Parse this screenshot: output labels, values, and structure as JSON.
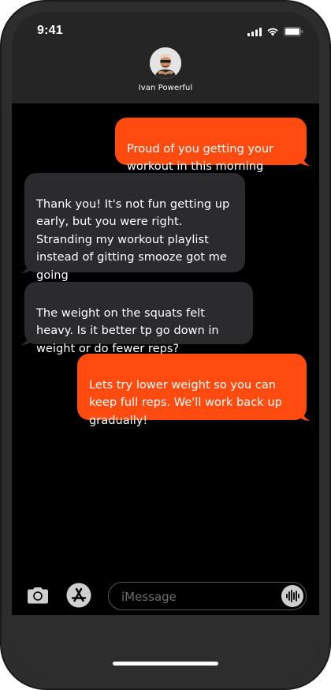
{
  "status_bar": {
    "time": "9:41",
    "icons": [
      "cellular-signal-icon",
      "wifi-icon",
      "battery-icon"
    ]
  },
  "contact": {
    "name": "Ivan Powerful",
    "avatar": "avatar-photo"
  },
  "messages": [
    {
      "direction": "outgoing",
      "text": "Proud of you getting your\nworkout in this morning"
    },
    {
      "direction": "incoming",
      "text": "Thank you!  It's not fun getting up\nearly, but you were right.\nStranding my workout playlist\ninstead of gitting smooze got me\ngoing"
    },
    {
      "direction": "incoming",
      "text": "The weight on the squats felt\nheavy. Is it better tp go down in\nweight or do fewer reps?"
    },
    {
      "direction": "outgoing",
      "text": "Lets try lower weight so you can\nkeep full reps. We'll work back up\ngradually!"
    }
  ],
  "composer": {
    "placeholder": "iMessage",
    "icons": [
      "camera-icon",
      "app-store-icon",
      "audio-waveform-icon"
    ]
  },
  "colors": {
    "outgoing_bubble": "#ff4b0f",
    "incoming_bubble": "#2b2b2d",
    "header": "#252525",
    "background": "#000000"
  }
}
